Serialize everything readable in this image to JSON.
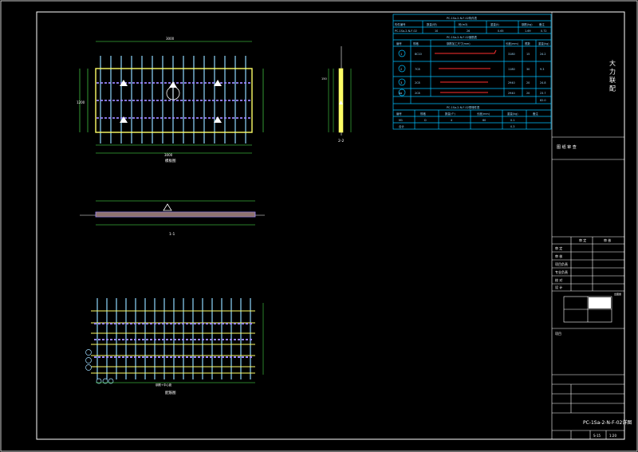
{
  "title_block": {
    "company": "大 力 联 配",
    "review_label": "图 纸 审 查",
    "grid_header_a": "审 定",
    "grid_header_b": "审 核",
    "rows": [
      "审 定",
      "审 核",
      "项目负责",
      "专业负责",
      "校 对",
      "设 计"
    ],
    "project_label": "项目",
    "code": "PC-1Sa-2-N-F-02详图",
    "sheet_no": "S-15",
    "scale": "1:20",
    "stamp_text": "出图章"
  },
  "table_top": {
    "title": "PC-1Sa-2-N-F-02构件表",
    "headers": [
      "构件编号",
      "数量(块)",
      "砼(m3)",
      "重量(t)",
      "钢筋(kg)",
      "备注"
    ],
    "row": [
      "PC-1Sa-2-N-F-02",
      "10",
      "26",
      "0.65",
      "1.69",
      "0.72"
    ]
  },
  "table_mid": {
    "title": "PC-1Sa-2-N-F-02钢筋表",
    "headers": [
      "编号",
      "规格",
      "钢筋加工尺寸(mm)",
      "长度(mm)",
      "根数",
      "重量(kg)"
    ],
    "rows": [
      {
        "id": "1",
        "spec": "8C10",
        "len": "3180",
        "n": "15",
        "w": "24.2"
      },
      {
        "id": "2",
        "spec": "7C8",
        "len": "1180",
        "n": "30",
        "w": "9.3"
      },
      {
        "id": "3",
        "spec": "2C8",
        "len": "2940",
        "n": "20",
        "w": "24.8"
      },
      {
        "id": "4a",
        "spec": "2C8",
        "len": "2940",
        "n": "20",
        "w": "23.7"
      }
    ],
    "total": "82.0"
  },
  "table_bot": {
    "title": "PC-1Sa-2-N-F-02预埋件表",
    "headers": [
      "编号",
      "规格",
      "数量(个)",
      "长度(mm)",
      "重量(kg)",
      "备注"
    ],
    "rows": [
      [
        "M1",
        "D",
        "4",
        "60",
        "0.1"
      ],
      [
        "合计",
        "",
        "",
        "",
        "0.3"
      ]
    ]
  },
  "views": {
    "plan": "模板图",
    "section11": "1-1",
    "section22": "2-2",
    "rebar": "配筋图"
  },
  "dims": {
    "total_width": "3000",
    "height": "1200",
    "side": "150",
    "bar_span": "1200",
    "rebar_total": "钢筋+中心距"
  },
  "colors": {
    "border": "#ffffff",
    "table": "#00bfff",
    "panel": "#ffff66",
    "rebar": "#9a86ff",
    "dimension": "#55ff55",
    "red": "#ff3030"
  }
}
